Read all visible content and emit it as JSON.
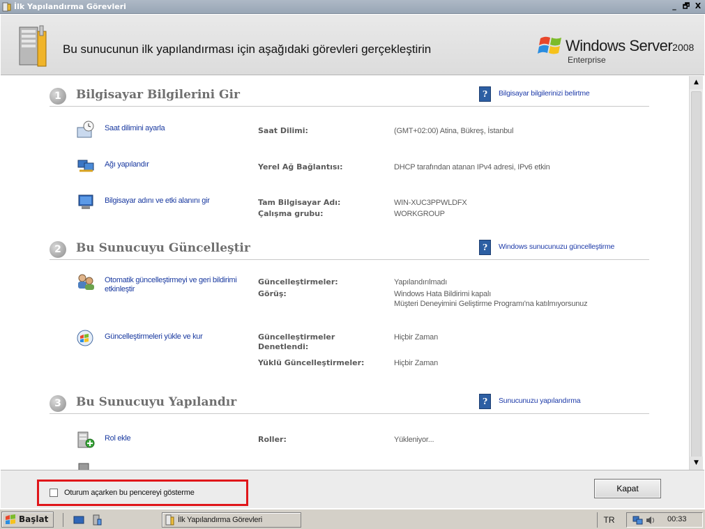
{
  "window": {
    "title": "İlk Yapılandırma Görevleri",
    "controls": [
      "_",
      "🗗",
      "X"
    ]
  },
  "header": {
    "instruction": "Bu sunucunun ilk yapılandırması için aşağıdaki görevleri gerçekleştirin",
    "brand_name": "Windows Server",
    "brand_year": "2008",
    "brand_edition": "Enterprise"
  },
  "sections": [
    {
      "number": "1",
      "title": "Bilgisayar Bilgilerini Gir",
      "help_link": "Bilgisayar bilgilerinizi belirtme",
      "tasks": [
        {
          "link": "Saat dilimini ayarla",
          "labels": [
            "Saat Dilimi:"
          ],
          "values": [
            "(GMT+02:00) Atina, Bükreş, İstanbul"
          ]
        },
        {
          "link": "Ağı yapılandır",
          "labels": [
            "Yerel Ağ Bağlantısı:"
          ],
          "values": [
            "DHCP tarafından atanan IPv4 adresi, IPv6 etkin"
          ]
        },
        {
          "link": "Bilgisayar adını ve etki alanını gir",
          "labels": [
            "Tam Bilgisayar Adı:",
            "Çalışma grubu:"
          ],
          "values": [
            "WIN-XUC3PPWLDFX",
            "WORKGROUP"
          ]
        }
      ]
    },
    {
      "number": "2",
      "title": "Bu Sunucuyu Güncelleştir",
      "help_link": "Windows sunucunuzu güncelleştirme",
      "tasks": [
        {
          "link": "Otomatik güncelleştirmeyi ve geri bildirimi etkinleştir",
          "labels": [
            "Güncelleştirmeler:",
            "Görüş:"
          ],
          "values": [
            "Yapılandırılmadı",
            "Windows Hata Bildirimi kapalı",
            "Müşteri Deneyimini Geliştirme Programı'na katılmıyorsunuz"
          ]
        },
        {
          "link": "Güncelleştirmeleri yükle ve kur",
          "labels": [
            "Güncelleştirmeler Denetlendi:",
            "Yüklü Güncelleştirmeler:"
          ],
          "values": [
            "Hiçbir Zaman",
            "Hiçbir Zaman"
          ]
        }
      ]
    },
    {
      "number": "3",
      "title": "Bu Sunucuyu Yapılandır",
      "help_link": "Sunucunuzu yapılandırma",
      "tasks": [
        {
          "link": "Rol ekle",
          "labels": [
            "Roller:"
          ],
          "values": [
            "Yükleniyor..."
          ]
        }
      ]
    }
  ],
  "footer": {
    "checkbox_label": "Oturum açarken bu pencereyi gösterme",
    "checkbox_checked": false,
    "close_button": "Kapat"
  },
  "taskbar": {
    "start_label": "Başlat",
    "task_button": "İlk Yapılandırma Görevleri",
    "language": "TR",
    "clock": "00:33"
  },
  "colors": {
    "link": "#1a3aa0",
    "highlight_border": "#e0161a",
    "section_title": "#6f6f6f"
  }
}
